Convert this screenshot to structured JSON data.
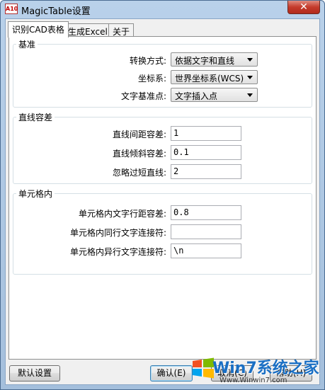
{
  "window": {
    "title": "MagicTable设置",
    "app_icon_text": "A10",
    "close_symbol": "✕"
  },
  "tabs": [
    {
      "label": "识别CAD表格",
      "active": true
    },
    {
      "label": "生成Excel",
      "active": false
    },
    {
      "label": "关于",
      "active": false
    }
  ],
  "groups": {
    "baseline": {
      "title": "基准",
      "convert_mode_label": "转换方式:",
      "convert_mode_value": "依据文字和直线",
      "coord_label": "坐标系:",
      "coord_value": "世界坐标系(WCS)",
      "text_base_label": "文字基准点:",
      "text_base_value": "文字插入点"
    },
    "line_tolerance": {
      "title": "直线容差",
      "spacing_label": "直线间距容差:",
      "spacing_value": "1",
      "tilt_label": "直线倾斜容差:",
      "tilt_value": "0.1",
      "ignore_label": "忽略过短直线:",
      "ignore_value": "2"
    },
    "cell": {
      "title": "单元格内",
      "row_spacing_label": "单元格内文字行距容差:",
      "row_spacing_value": "0.8",
      "same_row_label": "单元格内同行文字连接符:",
      "same_row_value": "",
      "diff_row_label": "单元格内异行文字连接符:",
      "diff_row_value": "\\n"
    }
  },
  "buttons": {
    "default_settings": "默认设置",
    "ok": "确认(E)",
    "cancel": "取消(C)",
    "help": "帮助(H)"
  },
  "watermark": {
    "brand": "Win7系统之家",
    "url": "Www.Winwin7.com"
  }
}
